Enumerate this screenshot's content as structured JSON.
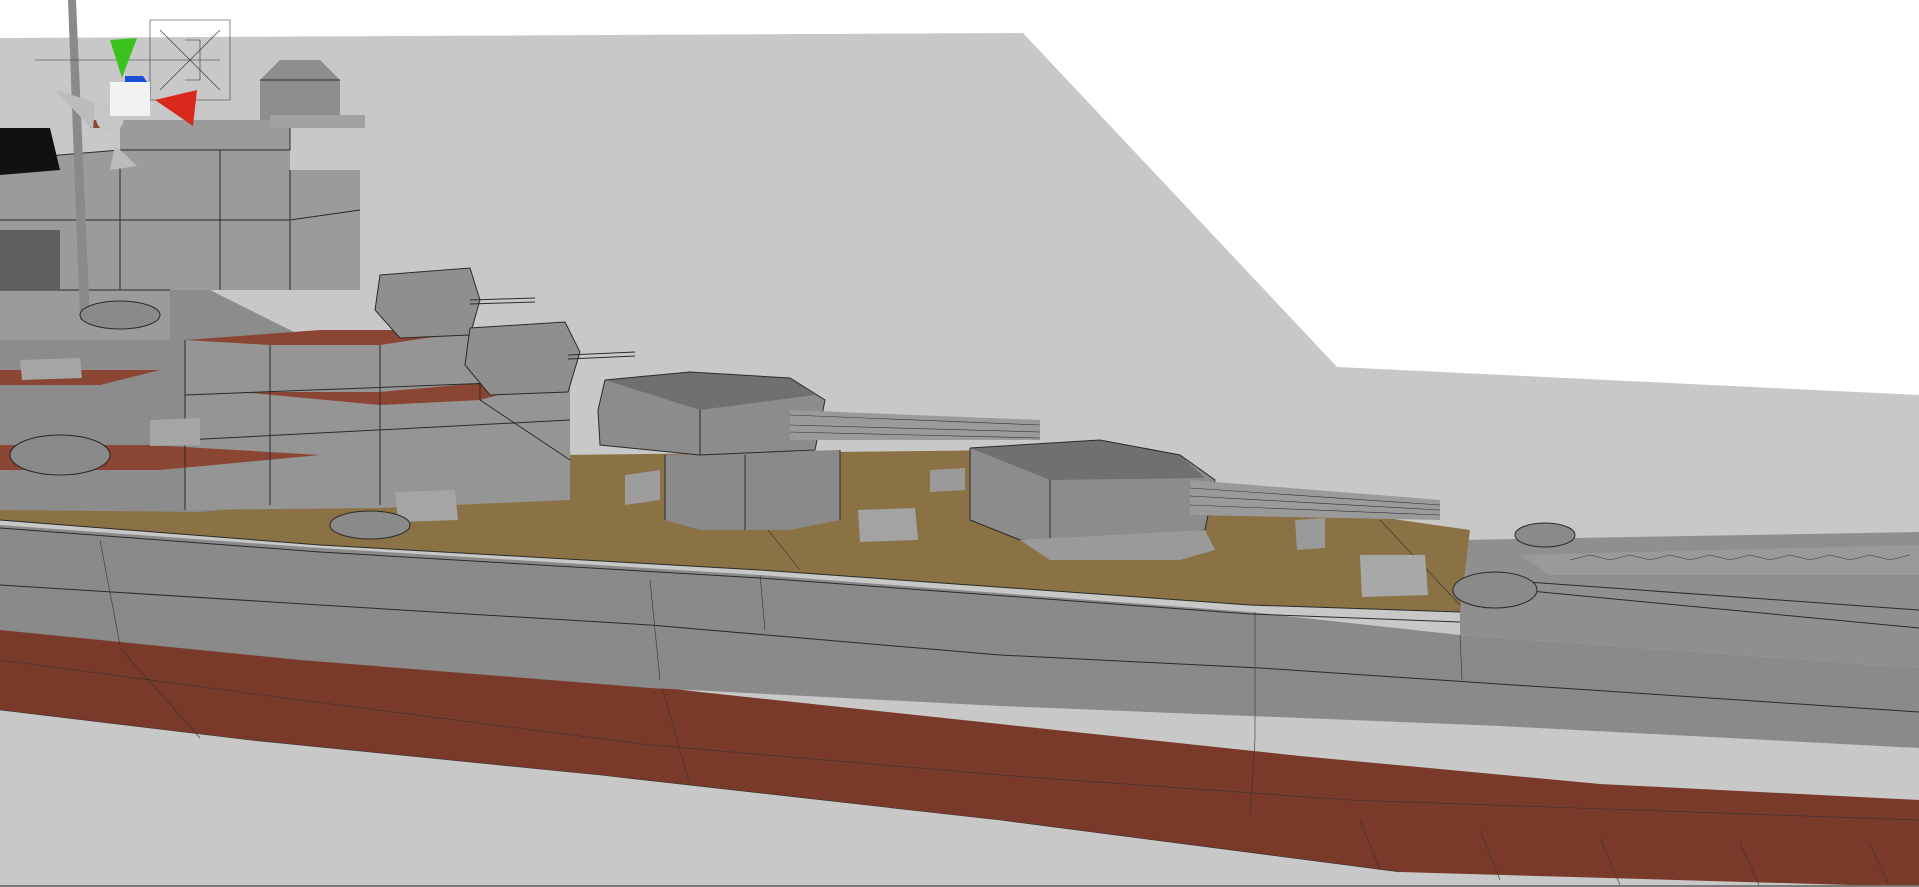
{
  "viewport": {
    "background": "#ffffff",
    "ground_color": "#c8c8c8",
    "hull_color": "#8a8a8a",
    "hull_light": "#9b9b9b",
    "hull_dark": "#767676",
    "boot_topping_color": "#7a3a2a",
    "deck_color": "#8a7244",
    "deck_red": "#8b4533",
    "turret_color": "#858585",
    "turret_top": "#707070",
    "edge_color": "#2a2a2a"
  },
  "gizmo": {
    "x_axis_color": "#d9281c",
    "y_axis_color": "#3cc21f",
    "z_axis_color": "#1c4fd9",
    "center_color": "#f2f2f2",
    "neg_axis_color": "#bcbcbc",
    "x_icon": "x-axis-cone-icon",
    "y_icon": "y-axis-cone-icon",
    "z_icon": "z-axis-cone-icon"
  }
}
